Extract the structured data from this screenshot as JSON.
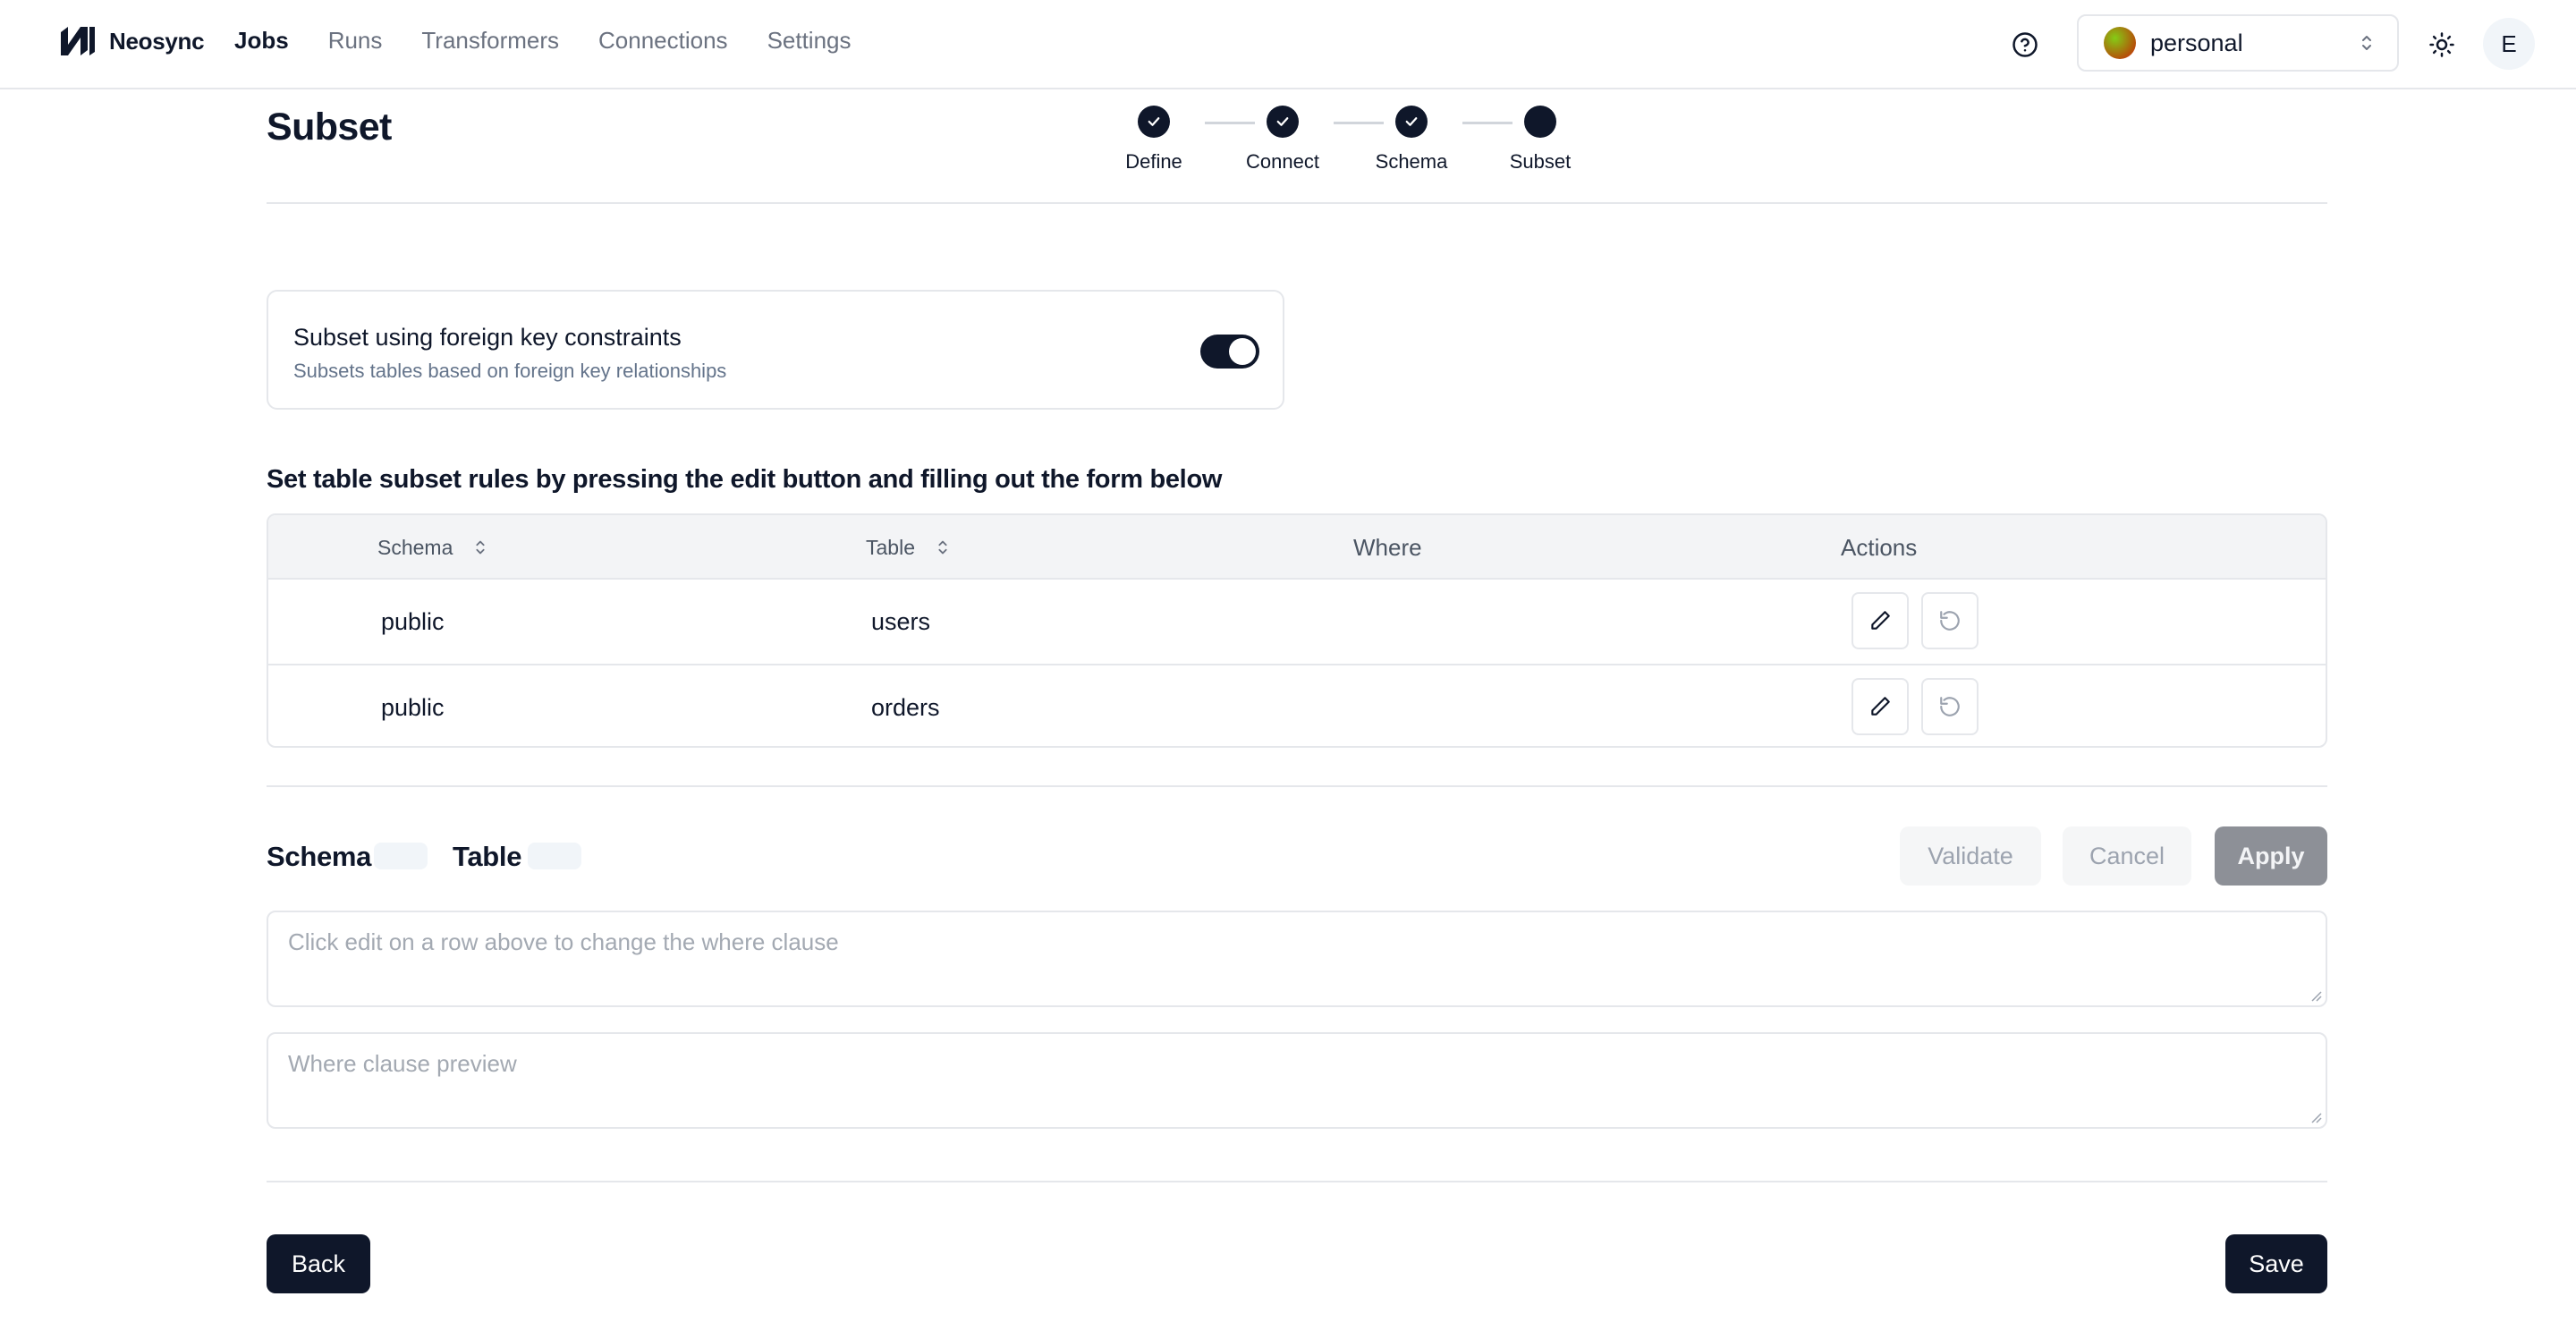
{
  "app": {
    "name": "Neosync",
    "nav": [
      "Jobs",
      "Runs",
      "Transformers",
      "Connections",
      "Settings"
    ],
    "active_nav": "Jobs",
    "account": "personal",
    "user_initial": "E"
  },
  "page": {
    "title": "Subset",
    "steps": [
      {
        "label": "Define",
        "state": "complete"
      },
      {
        "label": "Connect",
        "state": "complete"
      },
      {
        "label": "Schema",
        "state": "complete"
      },
      {
        "label": "Subset",
        "state": "current"
      }
    ]
  },
  "fk_setting": {
    "title": "Subset using foreign key constraints",
    "description": "Subsets tables based on foreign key relationships",
    "enabled": true
  },
  "rules": {
    "heading": "Set table subset rules by pressing the edit button and filling out the form below",
    "columns": {
      "schema": "Schema",
      "table": "Table",
      "where": "Where",
      "actions": "Actions"
    },
    "rows": [
      {
        "schema": "public",
        "table": "users",
        "where": ""
      },
      {
        "schema": "public",
        "table": "orders",
        "where": ""
      }
    ],
    "row_action_icons": [
      "pencil-icon",
      "reset-icon"
    ]
  },
  "editor": {
    "schema_label": "Schema",
    "table_label": "Table",
    "validate_label": "Validate",
    "cancel_label": "Cancel",
    "apply_label": "Apply",
    "where_placeholder": "Click edit on a row above to change the where clause",
    "preview_placeholder": "Where clause preview"
  },
  "footer": {
    "back_label": "Back",
    "save_label": "Save"
  },
  "colors": {
    "primary": "#0f172a",
    "border": "#e5e7eb",
    "muted_text": "#64748b",
    "disabled_button": "#8d9097"
  }
}
